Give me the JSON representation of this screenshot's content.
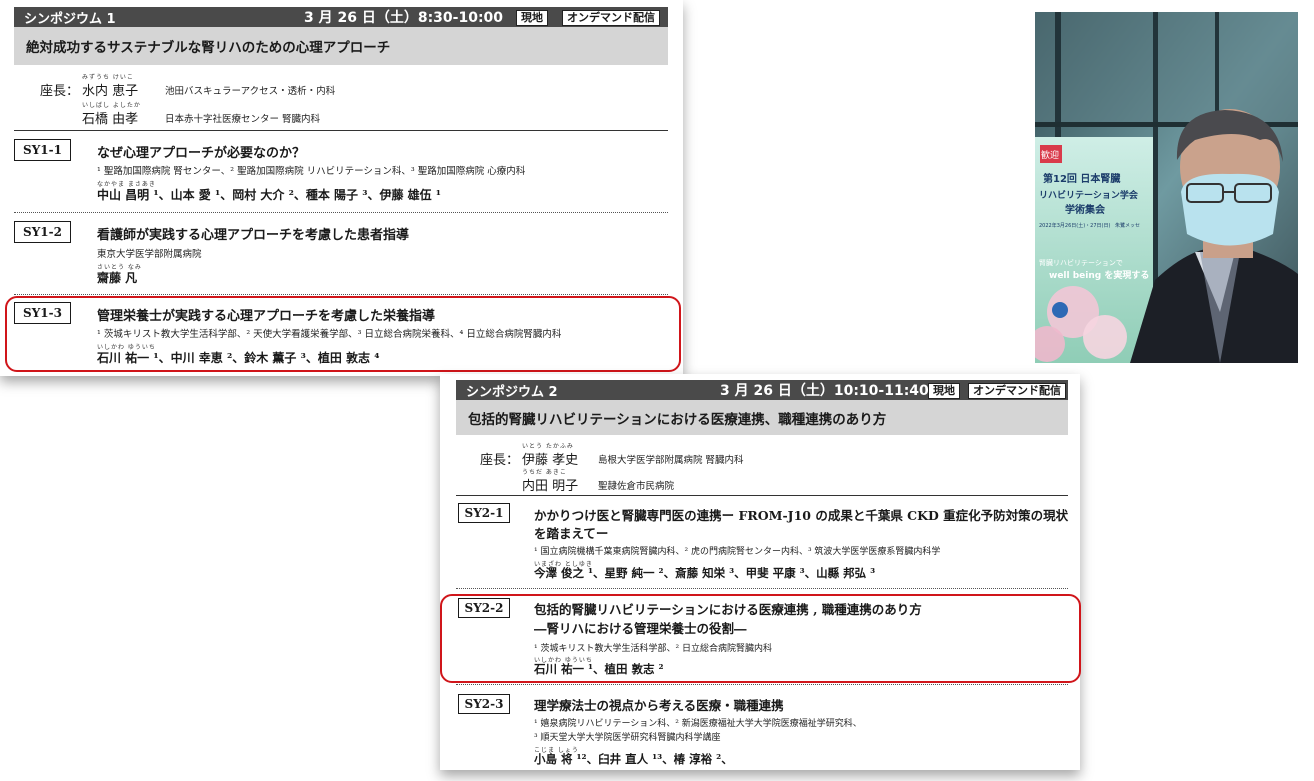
{
  "panel1": {
    "header": {
      "label": "シンポジウム 1",
      "datetime": "3 月 26 日（土）8:30-10:00",
      "onsite": "現地",
      "ondemand": "オンデマンド配信"
    },
    "subtitle": "絶対成功するサステナブルな腎リハのための心理アプローチ",
    "chair_label": "座長：",
    "chairs": [
      {
        "ruby": "みずうち けいこ",
        "name": "水内 恵子",
        "affiliation": "池田バスキュラーアクセス・透析・内科"
      },
      {
        "ruby": "いしばし よしたか",
        "name": "石橋 由孝",
        "affiliation": "日本赤十字社医療センター 腎臓内科"
      }
    ],
    "talks": [
      {
        "code": "SY1-1",
        "title": "なぜ心理アプローチが必要なのか？",
        "affiliation": "¹ 聖路加国際病院 腎センター、² 聖路加国際病院 リハビリテーション科、³ 聖路加国際病院 心療内科",
        "ruby": "なかやま まさあき",
        "authors": "中山 昌明 ¹、山本 愛 ¹、岡村 大介 ²、種本 陽子 ³、伊藤 雄伍 ¹"
      },
      {
        "code": "SY1-2",
        "title": "看護師が実践する心理アプローチを考慮した患者指導",
        "affiliation": "東京大学医学部附属病院",
        "ruby": "さいとう なみ",
        "authors": "齋藤 凡"
      },
      {
        "code": "SY1-3",
        "title": "管理栄養士が実践する心理アプローチを考慮した栄養指導",
        "affiliation": "¹ 茨城キリスト教大学生活科学部、² 天使大学看護栄養学部、³ 日立総合病院栄養科、⁴ 日立総合病院腎臓内科",
        "ruby": "いしかわ ゆういち",
        "authors": "石川 祐一 ¹、中川 幸恵 ²、鈴木 薫子 ³、植田 敦志 ⁴"
      }
    ]
  },
  "panel2": {
    "header": {
      "label": "シンポジウム 2",
      "datetime": "3 月 26 日（土）10:10-11:40",
      "onsite": "現地",
      "ondemand": "オンデマンド配信"
    },
    "subtitle": "包括的腎臓リハビリテーションにおける医療連携、職種連携のあり方",
    "chair_label": "座長：",
    "chairs": [
      {
        "ruby": "いとう たかふみ",
        "name": "伊藤 孝史",
        "affiliation": "島根大学医学部附属病院 腎臓内科"
      },
      {
        "ruby": "うちだ あきこ",
        "name": "内田 明子",
        "affiliation": "聖隷佐倉市民病院"
      }
    ],
    "talks": [
      {
        "code": "SY2-1",
        "title": "かかりつけ医と腎臓専門医の連携ー FROM-J10 の成果と千葉県 CKD 重症化予防対策の現状",
        "title2": "を踏まえてー",
        "affiliation": "¹ 国立病院機構千葉東病院腎臓内科、² 虎の門病院腎センター内科、³ 筑波大学医学医療系腎臓内科学",
        "ruby": "いまざわ としゆき",
        "authors": "今澤 俊之 ¹、星野 純一 ²、斎藤 知栄 ³、甲斐 平康 ³、山縣 邦弘 ³"
      },
      {
        "code": "SY2-2",
        "title": "包括的腎臓リハビリテーションにおける医療連携 , 職種連携のあり方",
        "title2": "―腎リハにおける管理栄養士の役割―",
        "affiliation": "¹ 茨城キリスト教大学生活科学部、² 日立総合病院腎臓内科",
        "ruby": "いしかわ ゆういち",
        "authors": "石川 祐一 ¹、植田 敦志 ²"
      },
      {
        "code": "SY2-3",
        "title": "理学療法士の視点から考える医療・職種連携",
        "affiliation": "¹ 嬉泉病院リハビリテーション科、² 新潟医療福祉大学大学院医療福祉学研究科、",
        "affiliation2": "³ 順天堂大学大学院医学研究科腎臓内科学講座",
        "ruby": "こじま しょう",
        "authors": "小島 将 ¹²、臼井 直人 ¹³、椿 淳裕 ²、"
      }
    ]
  },
  "photo": {
    "banner_lines": [
      "歓迎",
      "第12回 日本腎臓",
      "リハビリテーション学会",
      "学術集会"
    ],
    "banner_dates": "2022年3月26日(土)・27日(日)",
    "banner_venue": "朱鷺メッセ",
    "slogan": "腎臓リハビリテーションで",
    "slogan2": "well being を実現する",
    "colors": {
      "banner_green": "#74b9a0",
      "window_cyan": "#bfe6ee",
      "jacket": "#1c1f26"
    }
  }
}
